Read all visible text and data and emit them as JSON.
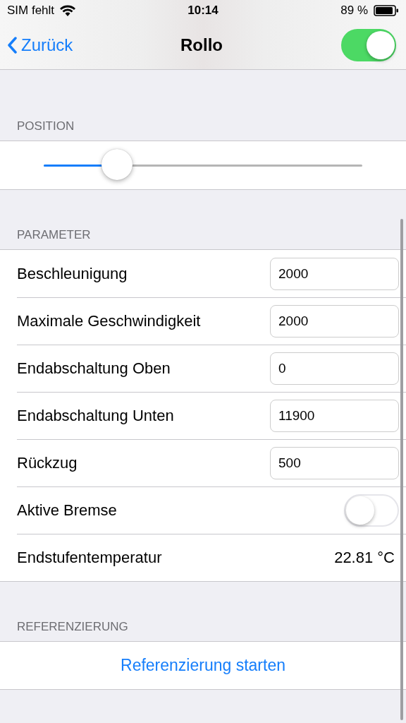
{
  "status_bar": {
    "carrier": "SIM fehlt",
    "time": "10:14",
    "battery": "89 %"
  },
  "nav": {
    "back": "Zurück",
    "title": "Rollo",
    "switch_on": true
  },
  "position": {
    "header": "POSITION",
    "level": 0.23
  },
  "parameter": {
    "header": "PARAMETER",
    "rows": [
      {
        "kind": "field",
        "label": "Beschleunigung",
        "value": "2000"
      },
      {
        "kind": "field",
        "label": "Maximale Geschwindigkeit",
        "value": "2000"
      },
      {
        "kind": "field",
        "label": "Endabschaltung Oben",
        "value": "0"
      },
      {
        "kind": "field",
        "label": "Endabschaltung Unten",
        "value": "11900"
      },
      {
        "kind": "field",
        "label": "Rückzug",
        "value": "500"
      },
      {
        "kind": "switch",
        "label": "Aktive Bremse",
        "on": false
      },
      {
        "kind": "value",
        "label": "Endstufentemperatur",
        "value": "22.81 °C"
      }
    ]
  },
  "referenzierung": {
    "header": "REFERENZIERUNG",
    "button": "Referenzierung starten"
  }
}
